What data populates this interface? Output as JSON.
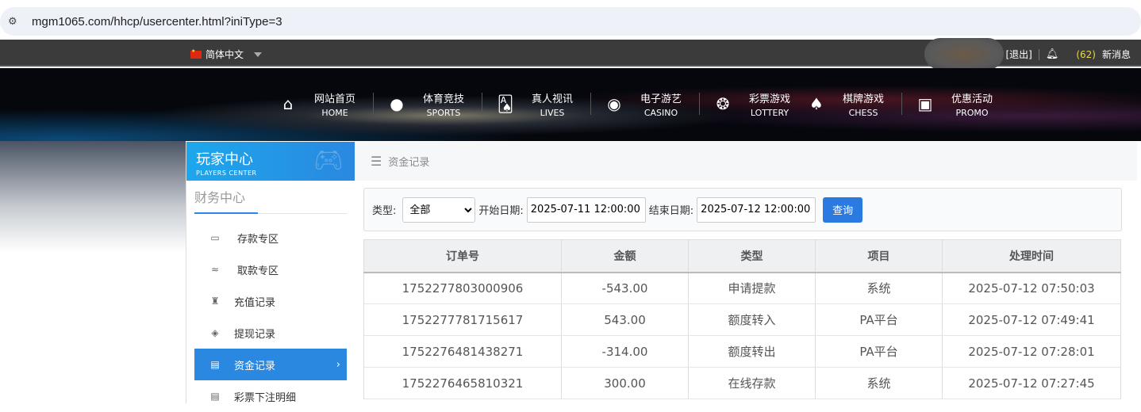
{
  "browser": {
    "url": "mgm1065.com/hhcp/usercenter.html?iniType=3"
  },
  "topbar": {
    "language": "简体中文",
    "logout": "[退出]",
    "message_count": "(62)",
    "messages": "新消息"
  },
  "nav": [
    {
      "cn": "网站首页",
      "en": "HOME",
      "icon": "home-icon",
      "glyph": "⌂"
    },
    {
      "cn": "体育竞技",
      "en": "SPORTS",
      "icon": "ball-icon",
      "glyph": "●"
    },
    {
      "cn": "真人视讯",
      "en": "LIVES",
      "icon": "cards-icon",
      "glyph": "🂡"
    },
    {
      "cn": "电子游艺",
      "en": "CASINO",
      "icon": "roulette-icon",
      "glyph": "◉"
    },
    {
      "cn": "彩票游戏",
      "en": "LOTTERY",
      "icon": "lottery-balls-icon",
      "glyph": "❂"
    },
    {
      "cn": "棋牌游戏",
      "en": "CHESS",
      "icon": "spade-icon",
      "glyph": "♠"
    },
    {
      "cn": "优惠活动",
      "en": "PROMO",
      "icon": "gift-icon",
      "glyph": "▣"
    }
  ],
  "sidebar": {
    "title_cn": "玩家中心",
    "title_en": "PLAYERS CENTER",
    "section": "财务中心",
    "items": [
      {
        "label": "存款专区",
        "icon": "card-icon",
        "glyph": "▭"
      },
      {
        "label": "取款专区",
        "icon": "hand-cash-icon",
        "glyph": "≈"
      },
      {
        "label": "充值记录",
        "icon": "money-bag-icon",
        "glyph": "♜"
      },
      {
        "label": "提现记录",
        "icon": "wallet-icon",
        "glyph": "◈"
      },
      {
        "label": "资金记录",
        "icon": "cash-icon",
        "glyph": "▤",
        "active": true
      },
      {
        "label": "彩票下注明细",
        "icon": "list-icon",
        "glyph": "▤"
      }
    ]
  },
  "main": {
    "breadcrumb": "资金记录",
    "filter": {
      "type_label": "类型:",
      "type_value": "全部",
      "start_label": "开始日期:",
      "start_value": "2025-07-11 12:00:00",
      "end_label": "结束日期:",
      "end_value": "2025-07-12 12:00:00",
      "query": "查询"
    },
    "table": {
      "headers": [
        "订单号",
        "金额",
        "类型",
        "项目",
        "处理时间"
      ],
      "rows": [
        [
          "1752277803000906",
          "-543.00",
          "申请提款",
          "系统",
          "2025-07-12 07:50:03"
        ],
        [
          "1752277781715617",
          "543.00",
          "额度转入",
          "PA平台",
          "2025-07-12 07:49:41"
        ],
        [
          "1752276481438271",
          "-314.00",
          "额度转出",
          "PA平台",
          "2025-07-12 07:28:01"
        ],
        [
          "1752276465810321",
          "300.00",
          "在线存款",
          "系统",
          "2025-07-12 07:27:45"
        ]
      ]
    }
  }
}
